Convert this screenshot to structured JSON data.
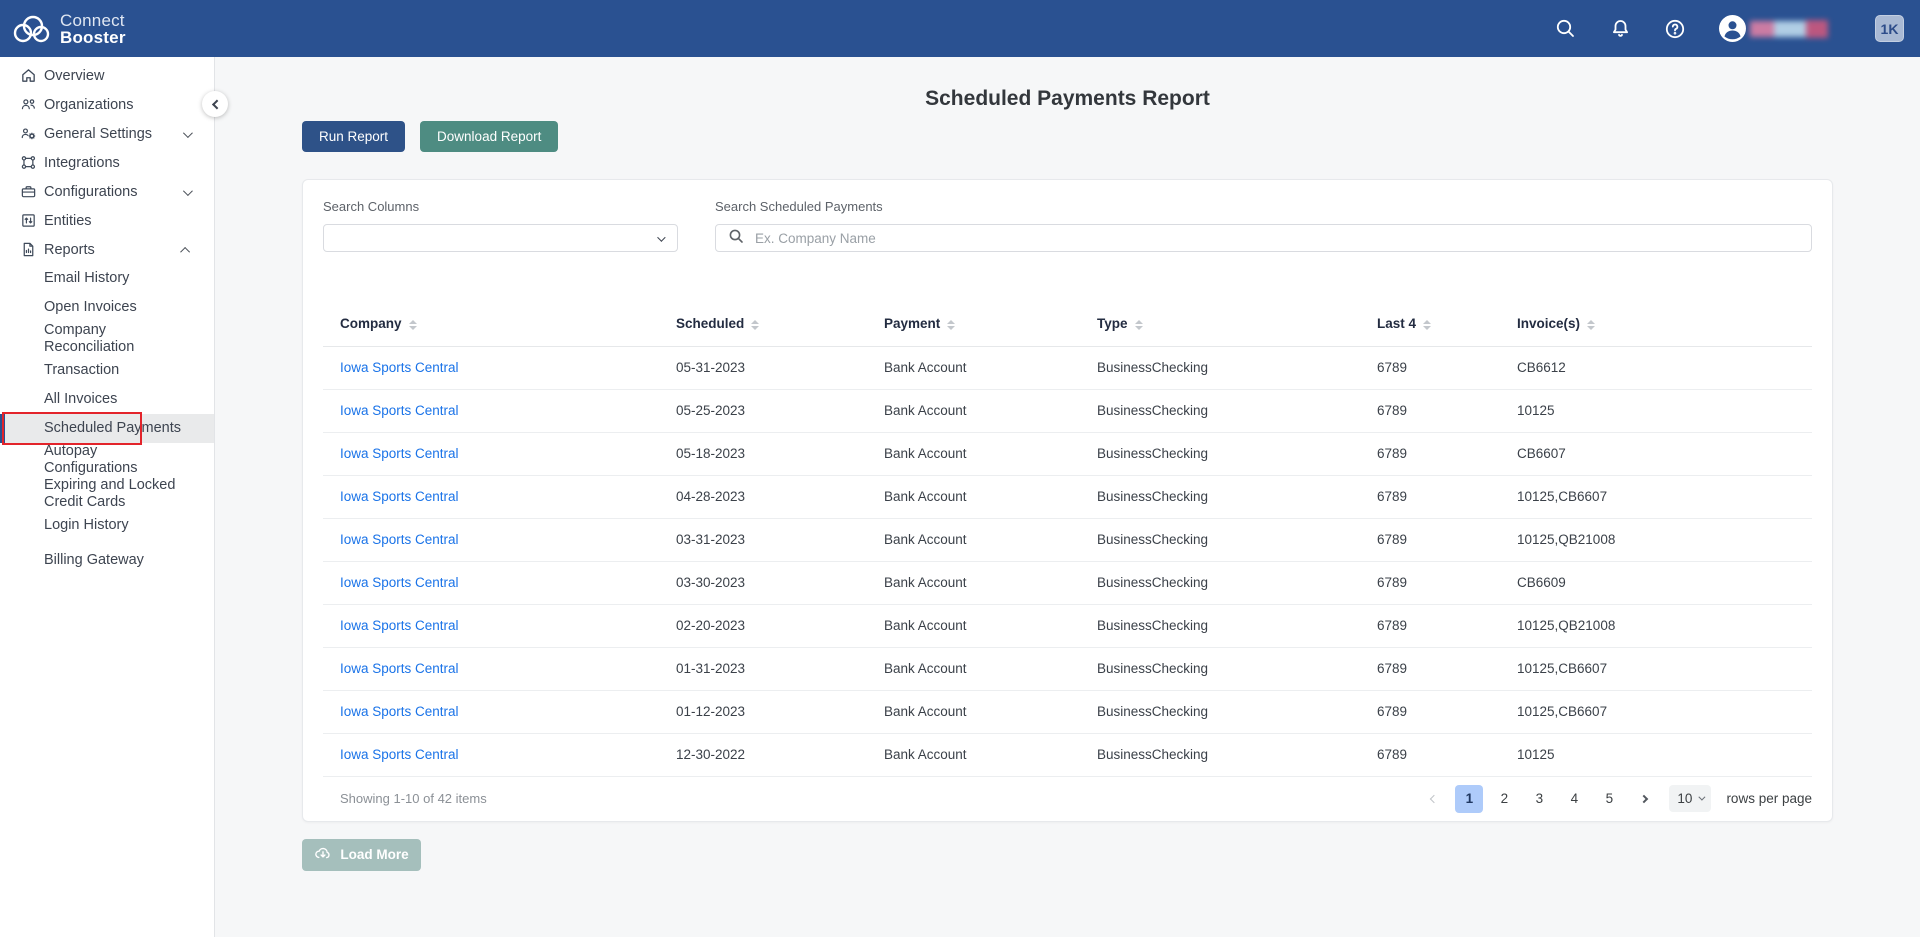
{
  "brand": {
    "line1": "Connect",
    "line2": "Booster"
  },
  "header": {
    "badge": "1K"
  },
  "sidebar": {
    "items": [
      {
        "label": "Overview"
      },
      {
        "label": "Organizations"
      },
      {
        "label": "General Settings",
        "chevron": "down"
      },
      {
        "label": "Integrations"
      },
      {
        "label": "Configurations",
        "chevron": "down"
      },
      {
        "label": "Entities"
      },
      {
        "label": "Reports",
        "chevron": "up"
      }
    ],
    "report_items": [
      {
        "label": "Email History"
      },
      {
        "label": "Open Invoices"
      },
      {
        "label": "Company Reconciliation"
      },
      {
        "label": "Transaction"
      },
      {
        "label": "All Invoices"
      },
      {
        "label": "Scheduled Payments",
        "active": true
      },
      {
        "label": "Autopay Configurations"
      },
      {
        "label": "Expiring and Locked Credit Cards"
      },
      {
        "label": "Login History"
      },
      {
        "label": "Billing Gateway"
      }
    ]
  },
  "page": {
    "title": "Scheduled Payments Report",
    "run_button": "Run Report",
    "download_button": "Download Report"
  },
  "filters": {
    "columns_label": "Search Columns",
    "search_label": "Search Scheduled Payments",
    "search_placeholder": "Ex. Company Name"
  },
  "table": {
    "headers": [
      "Company",
      "Scheduled",
      "Payment",
      "Type",
      "Last 4",
      "Invoice(s)"
    ],
    "rows": [
      {
        "company": "Iowa Sports Central",
        "scheduled": "05-31-2023",
        "payment": "Bank Account",
        "type": "BusinessChecking",
        "last4": "6789",
        "invoices": "CB6612"
      },
      {
        "company": "Iowa Sports Central",
        "scheduled": "05-25-2023",
        "payment": "Bank Account",
        "type": "BusinessChecking",
        "last4": "6789",
        "invoices": "10125"
      },
      {
        "company": "Iowa Sports Central",
        "scheduled": "05-18-2023",
        "payment": "Bank Account",
        "type": "BusinessChecking",
        "last4": "6789",
        "invoices": "CB6607"
      },
      {
        "company": "Iowa Sports Central",
        "scheduled": "04-28-2023",
        "payment": "Bank Account",
        "type": "BusinessChecking",
        "last4": "6789",
        "invoices": "10125,CB6607"
      },
      {
        "company": "Iowa Sports Central",
        "scheduled": "03-31-2023",
        "payment": "Bank Account",
        "type": "BusinessChecking",
        "last4": "6789",
        "invoices": "10125,QB21008"
      },
      {
        "company": "Iowa Sports Central",
        "scheduled": "03-30-2023",
        "payment": "Bank Account",
        "type": "BusinessChecking",
        "last4": "6789",
        "invoices": "CB6609"
      },
      {
        "company": "Iowa Sports Central",
        "scheduled": "02-20-2023",
        "payment": "Bank Account",
        "type": "BusinessChecking",
        "last4": "6789",
        "invoices": "10125,QB21008"
      },
      {
        "company": "Iowa Sports Central",
        "scheduled": "01-31-2023",
        "payment": "Bank Account",
        "type": "BusinessChecking",
        "last4": "6789",
        "invoices": "10125,CB6607"
      },
      {
        "company": "Iowa Sports Central",
        "scheduled": "01-12-2023",
        "payment": "Bank Account",
        "type": "BusinessChecking",
        "last4": "6789",
        "invoices": "10125,CB6607"
      },
      {
        "company": "Iowa Sports Central",
        "scheduled": "12-30-2022",
        "payment": "Bank Account",
        "type": "BusinessChecking",
        "last4": "6789",
        "invoices": "10125"
      }
    ]
  },
  "pagination": {
    "summary": "Showing 1-10 of 42 items",
    "pages": [
      "1",
      "2",
      "3",
      "4",
      "5"
    ],
    "active_page": "1",
    "page_size": "10",
    "rows_per_page_label": "rows per page"
  },
  "footer": {
    "load_more": "Load More"
  },
  "icons": [
    "cloud-logo-icon",
    "search-icon",
    "bell-icon",
    "help-icon",
    "avatar-icon",
    "home-icon",
    "organizations-icon",
    "settings-icon",
    "integrations-icon",
    "configurations-icon",
    "entities-icon",
    "reports-icon",
    "chevron-icons",
    "sort-icon",
    "cloud-download-icon"
  ],
  "colors": {
    "header_bg": "#2a5191",
    "run_button": "#2e5288",
    "download_button": "#4e8c82",
    "link": "#1a73e8",
    "active_page_bg": "#aecbfa",
    "active_nav_bg": "#e9eaeb",
    "annotation_red": "#e3242b",
    "load_more": "#a5bfbc"
  }
}
